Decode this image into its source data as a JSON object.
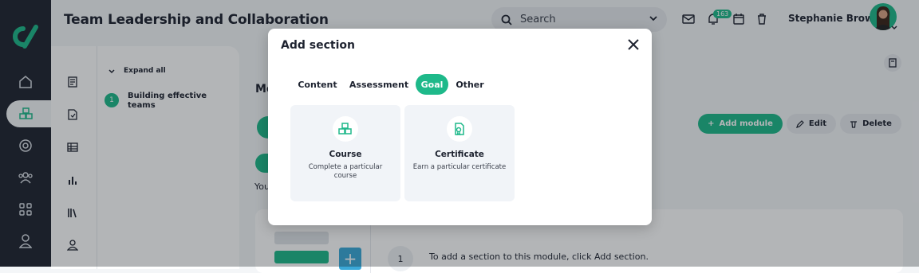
{
  "header": {
    "title": "Team Leadership and Collaboration",
    "search_placeholder": "Search",
    "notification_count": "163",
    "user_name": "Stephanie Brown"
  },
  "outline": {
    "expand_all": "Expand all",
    "steps": [
      {
        "number": "1",
        "label": "Building effective teams"
      }
    ]
  },
  "main": {
    "heading_partial": "Mo",
    "text_partial": "You",
    "add_module_label": "Add module",
    "edit_label": "Edit",
    "delete_label": "Delete",
    "row_number": "1",
    "hint": "To add a section to this module, click Add section."
  },
  "modal": {
    "title": "Add section",
    "tabs": [
      {
        "label": "Content",
        "active": false
      },
      {
        "label": "Assessment",
        "active": false
      },
      {
        "label": "Goal",
        "active": true
      },
      {
        "label": "Other",
        "active": false
      }
    ],
    "cards": [
      {
        "title": "Course",
        "description": "Complete a particular course",
        "icon": "cubes-icon"
      },
      {
        "title": "Certificate",
        "description": "Earn a particular certificate",
        "icon": "certificate-icon"
      }
    ]
  },
  "colors": {
    "accent": "#1eb98a",
    "sidebar": "#1f2430"
  }
}
